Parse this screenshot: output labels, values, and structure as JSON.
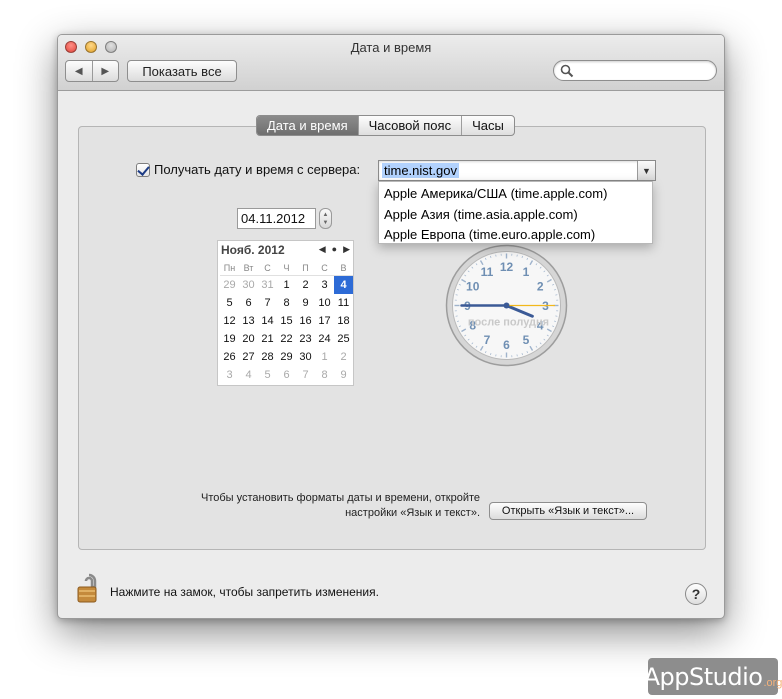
{
  "window": {
    "title": "Дата и время"
  },
  "toolbar": {
    "back_glyph": "◀",
    "forward_glyph": "▶",
    "show_all_label": "Показать все",
    "search_value": ""
  },
  "tabs": [
    {
      "label": "Дата и время",
      "active": true
    },
    {
      "label": "Часовой пояс",
      "active": false
    },
    {
      "label": "Часы",
      "active": false
    }
  ],
  "server": {
    "checkbox_label": "Получать дату и время с сервера:",
    "checked": true,
    "value": "time.nist.gov",
    "options": [
      "Apple Америка/США (time.apple.com)",
      "Apple Азия (time.asia.apple.com)",
      "Apple Европа (time.euro.apple.com)"
    ]
  },
  "date_field": {
    "value": "04.11.2012"
  },
  "calendar": {
    "month_label": "Нояб. 2012",
    "weekdays": [
      "Пн",
      "Вт",
      "С",
      "Ч",
      "П",
      "С",
      "В"
    ],
    "days": [
      {
        "d": "29",
        "m": true
      },
      {
        "d": "30",
        "m": true
      },
      {
        "d": "31",
        "m": true
      },
      {
        "d": "1"
      },
      {
        "d": "2"
      },
      {
        "d": "3"
      },
      {
        "d": "4",
        "s": true
      },
      {
        "d": "5"
      },
      {
        "d": "6"
      },
      {
        "d": "7"
      },
      {
        "d": "8"
      },
      {
        "d": "9"
      },
      {
        "d": "10"
      },
      {
        "d": "11"
      },
      {
        "d": "12"
      },
      {
        "d": "13"
      },
      {
        "d": "14"
      },
      {
        "d": "15"
      },
      {
        "d": "16"
      },
      {
        "d": "17"
      },
      {
        "d": "18"
      },
      {
        "d": "19"
      },
      {
        "d": "20"
      },
      {
        "d": "21"
      },
      {
        "d": "22"
      },
      {
        "d": "23"
      },
      {
        "d": "24"
      },
      {
        "d": "25"
      },
      {
        "d": "26"
      },
      {
        "d": "27"
      },
      {
        "d": "28"
      },
      {
        "d": "29"
      },
      {
        "d": "30"
      },
      {
        "d": "1",
        "m": true
      },
      {
        "d": "2",
        "m": true
      },
      {
        "d": "3",
        "m": true
      },
      {
        "d": "4",
        "m": true
      },
      {
        "d": "5",
        "m": true
      },
      {
        "d": "6",
        "m": true
      },
      {
        "d": "7",
        "m": true
      },
      {
        "d": "8",
        "m": true
      },
      {
        "d": "9",
        "m": true
      }
    ]
  },
  "clock": {
    "numbers": [
      "12",
      "1",
      "2",
      "3",
      "4",
      "5",
      "6",
      "7",
      "8",
      "9",
      "10",
      "11"
    ],
    "period_label": "после полудня",
    "time": {
      "hour": 3,
      "minute": 45,
      "second": 15
    },
    "number_color": "#6f8fb3",
    "hand_color": "#3b5a96",
    "second_hand_color": "#f2b81c"
  },
  "hint": {
    "line1": "Чтобы установить форматы даты и времени, откройте",
    "line2": "настройки «Язык и текст»."
  },
  "open_button": {
    "label": "Открыть «Язык и текст»..."
  },
  "lock": {
    "text": "Нажмите на замок, чтобы запретить изменения."
  },
  "help": {
    "label": "?"
  },
  "watermark": {
    "brand": "AppStudio",
    "tld": ".org"
  }
}
